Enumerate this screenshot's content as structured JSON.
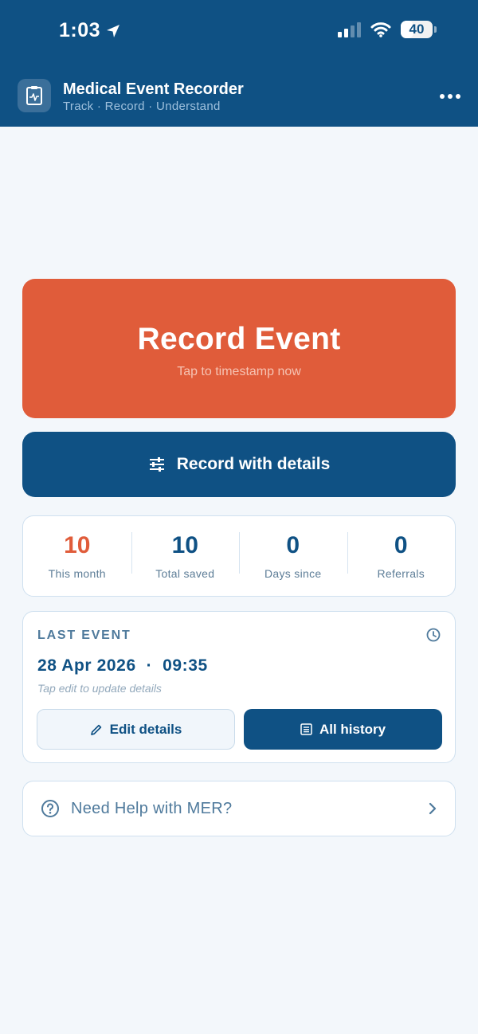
{
  "status_bar": {
    "time": "1:03",
    "battery_level": "40",
    "battery_percent": 40
  },
  "app": {
    "title": "Medical Event Recorder",
    "subtitle": "Track · Record · Understand",
    "logo_icon": "clipboard-pulse-icon"
  },
  "record": {
    "title": "Record Event",
    "subtitle": "Tap to timestamp now"
  },
  "details_button": {
    "label": "Record with details",
    "icon": "sliders-icon"
  },
  "stats": [
    {
      "value": "10",
      "label": "This month"
    },
    {
      "value": "10",
      "label": "Total saved"
    },
    {
      "value": "0",
      "label": "Days since"
    },
    {
      "value": "0",
      "label": "Referrals"
    }
  ],
  "last_event": {
    "heading": "LAST EVENT",
    "date": "28 Apr 2026",
    "separator": "·",
    "time": "09:35",
    "hint": "Tap edit to update details",
    "edit_label": "Edit details",
    "history_label": "All history"
  },
  "help": {
    "label": "Need Help with MER?"
  },
  "colors": {
    "header": "#0f5184",
    "record": "#e05c3a",
    "accent_stat": "#e05c3a",
    "background": "#f3f7fb"
  }
}
